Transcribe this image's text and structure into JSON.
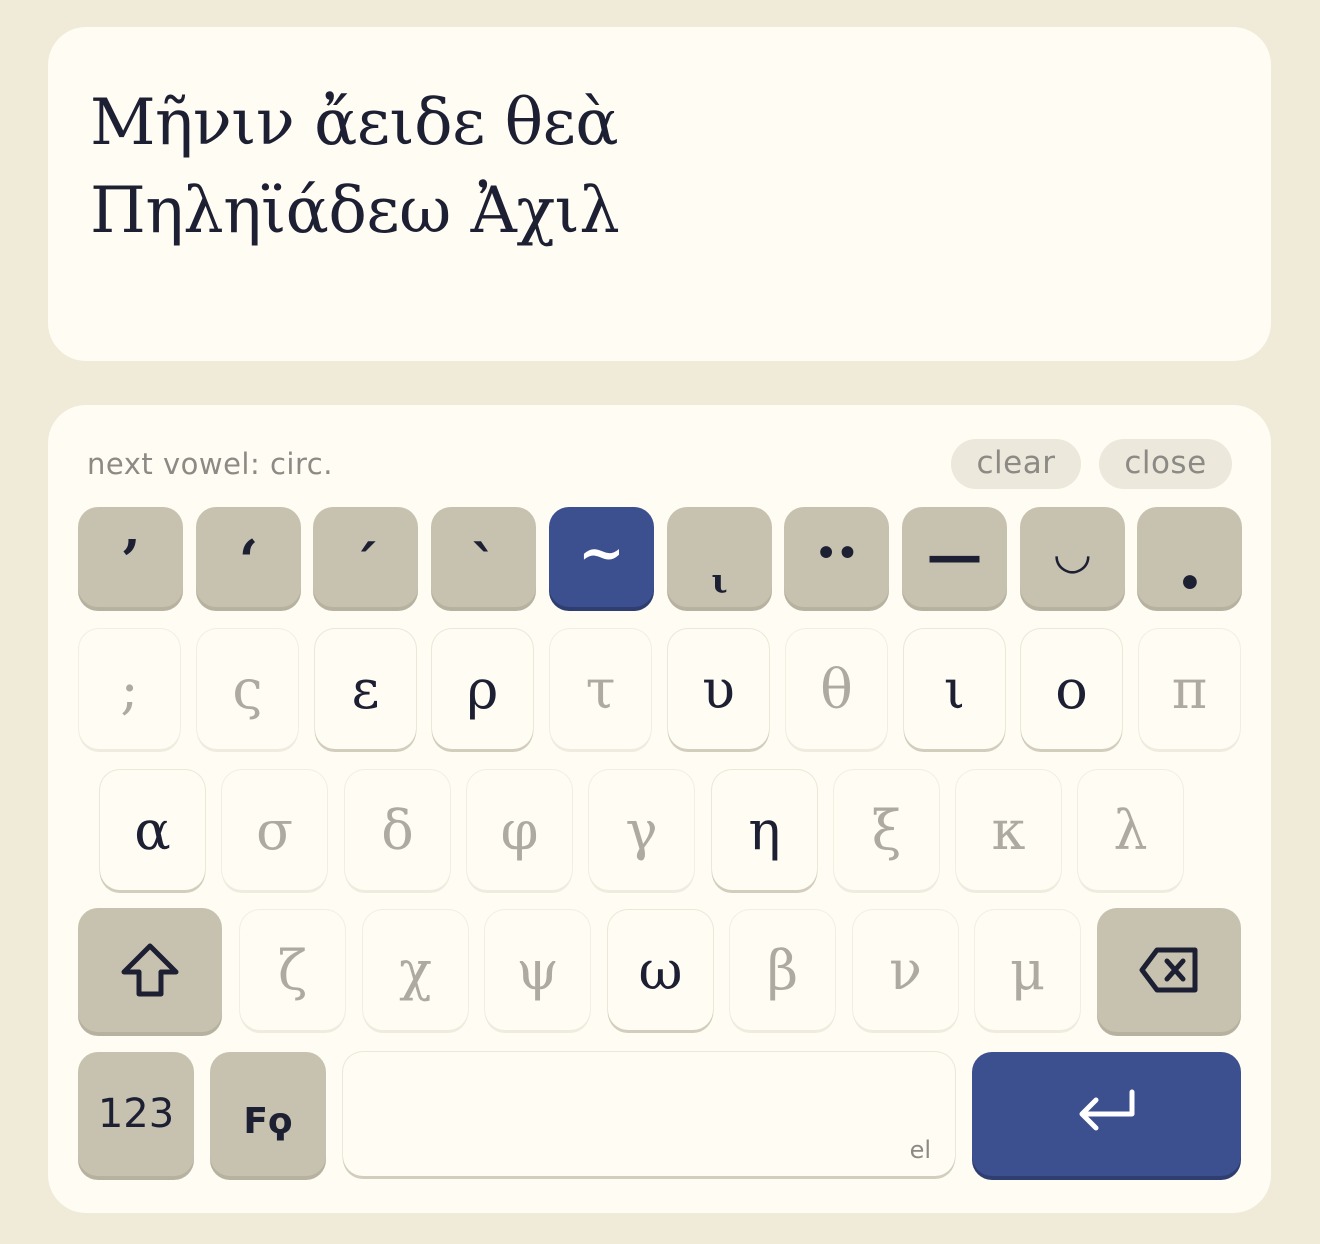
{
  "editor": {
    "text": "Μῆνιν ἄειδε θεὰ\nΠηληϊάδεω Ἀχιλ"
  },
  "toolbar": {
    "status": "next vowel: circ.",
    "clear_label": "clear",
    "close_label": "close"
  },
  "diacritics": [
    {
      "name": "smooth-breathing",
      "glyph": "’",
      "active": false
    },
    {
      "name": "rough-breathing",
      "glyph": "‘",
      "active": false
    },
    {
      "name": "acute",
      "glyph": "ˊ",
      "active": false
    },
    {
      "name": "grave",
      "glyph": "ˋ",
      "active": false
    },
    {
      "name": "circumflex",
      "glyph": "~",
      "active": true
    },
    {
      "name": "iota-subscript",
      "glyph": "ι",
      "active": false
    },
    {
      "name": "diaeresis",
      "glyph": "••",
      "active": false
    },
    {
      "name": "macron",
      "glyph": "—",
      "active": false
    },
    {
      "name": "breve",
      "glyph": "◡",
      "active": false
    },
    {
      "name": "dot",
      "glyph": "•",
      "active": false
    }
  ],
  "rows": {
    "row1": [
      {
        "char": ";",
        "enabled": false
      },
      {
        "char": "ς",
        "enabled": false
      },
      {
        "char": "ε",
        "enabled": true
      },
      {
        "char": "ρ",
        "enabled": true
      },
      {
        "char": "τ",
        "enabled": false
      },
      {
        "char": "υ",
        "enabled": true
      },
      {
        "char": "θ",
        "enabled": false
      },
      {
        "char": "ι",
        "enabled": true
      },
      {
        "char": "ο",
        "enabled": true
      },
      {
        "char": "π",
        "enabled": false
      }
    ],
    "row2": [
      {
        "char": "α",
        "enabled": true
      },
      {
        "char": "σ",
        "enabled": false
      },
      {
        "char": "δ",
        "enabled": false
      },
      {
        "char": "φ",
        "enabled": false
      },
      {
        "char": "γ",
        "enabled": false
      },
      {
        "char": "η",
        "enabled": true
      },
      {
        "char": "ξ",
        "enabled": false
      },
      {
        "char": "κ",
        "enabled": false
      },
      {
        "char": "λ",
        "enabled": false
      }
    ],
    "row3": [
      {
        "char": "ζ",
        "enabled": false
      },
      {
        "char": "χ",
        "enabled": false
      },
      {
        "char": "ψ",
        "enabled": false
      },
      {
        "char": "ω",
        "enabled": true
      },
      {
        "char": "β",
        "enabled": false
      },
      {
        "char": "ν",
        "enabled": false
      },
      {
        "char": "μ",
        "enabled": false
      }
    ]
  },
  "bottom": {
    "numbers_label": "123",
    "alt_label": "Fϙ",
    "space_lang": "el"
  },
  "icons": {
    "shift": "shift-icon",
    "backspace": "backspace-icon",
    "enter": "enter-icon"
  },
  "colors": {
    "accent": "#3c4f8e",
    "function_key": "#c7c2b0",
    "panel": "#fefcf3",
    "background": "#f0ead9",
    "text": "#1d1f33",
    "disabled_text": "#aeaaa2"
  }
}
